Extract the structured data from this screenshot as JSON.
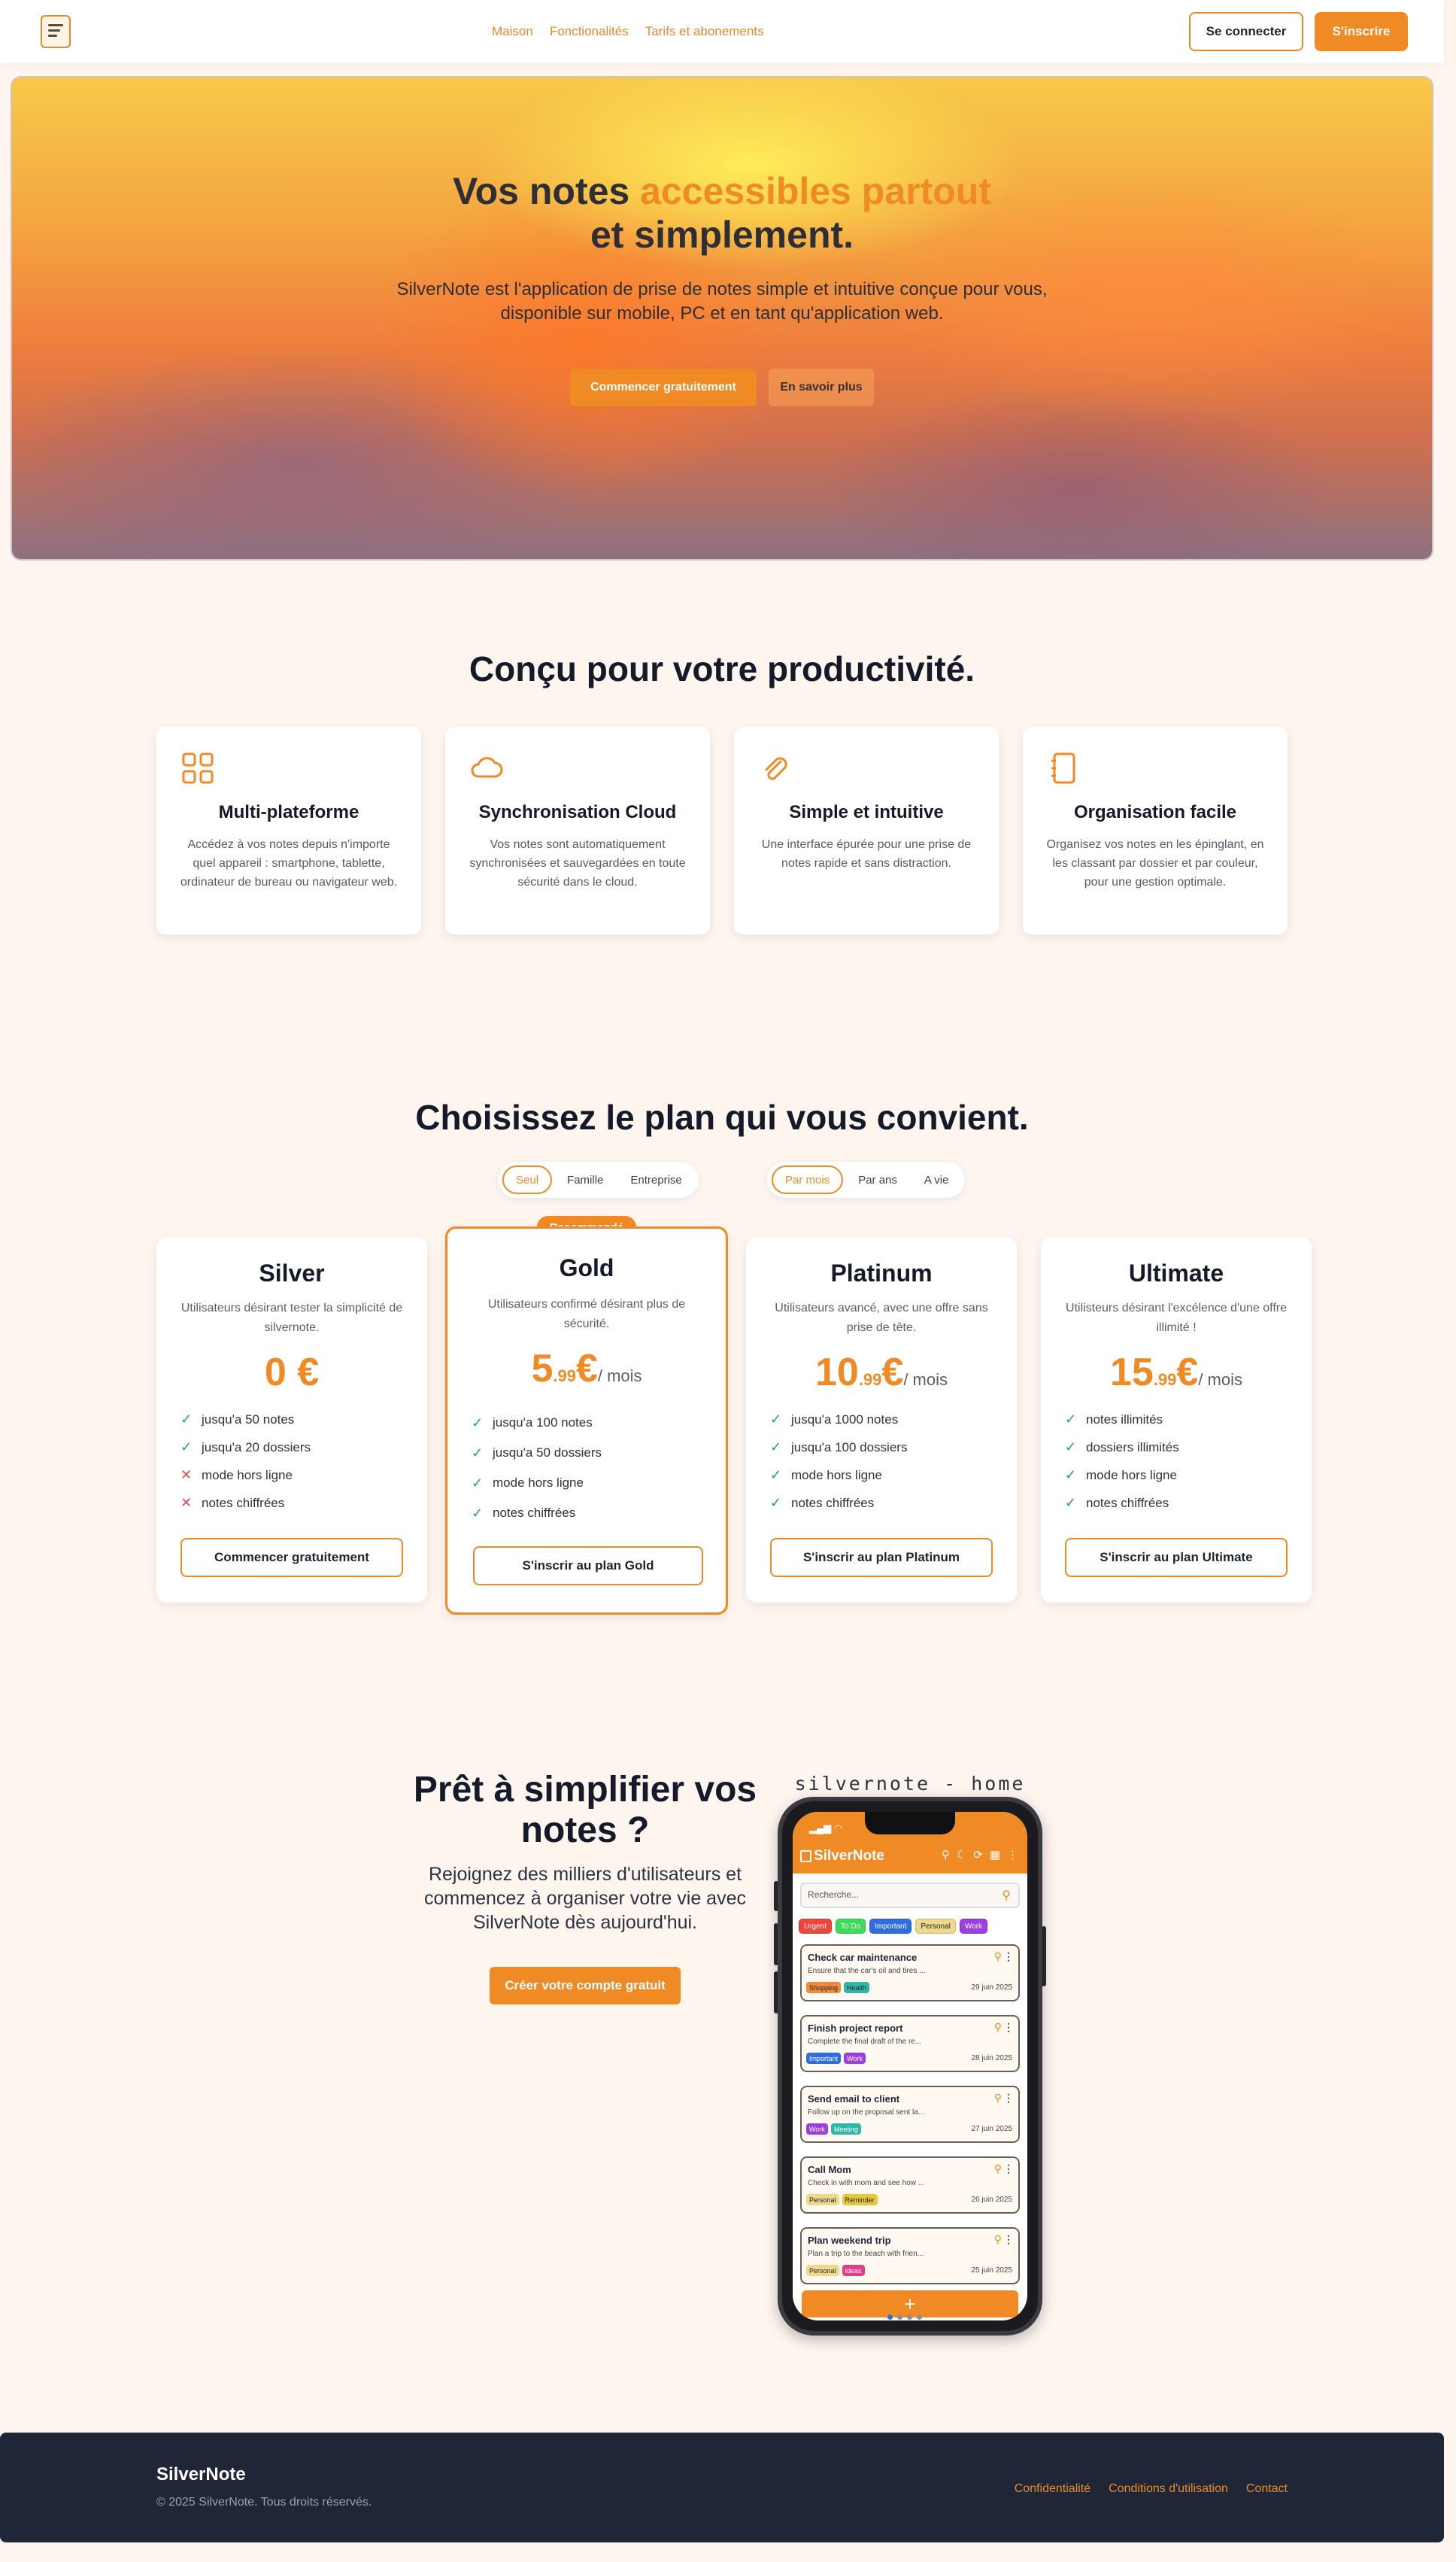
{
  "nav": {
    "links": [
      "Maison",
      "Fonctionalités",
      "Tarifs et abonements"
    ],
    "login": "Se connecter",
    "signup": "S'inscrire"
  },
  "hero": {
    "title_before": "Vos notes ",
    "title_accent": "accessibles partout",
    "title_after": " et simplement.",
    "subtitle": "SilverNote est l'application de prise de notes simple et intuitive conçue pour vous, disponible sur mobile, PC et en tant qu'application web.",
    "cta_primary": "Commencer gratuitement",
    "cta_secondary": "En savoir plus"
  },
  "features": {
    "title": "Conçu pour votre productivité.",
    "items": [
      {
        "icon": "grid-icon",
        "title": "Multi-plateforme",
        "desc": "Accédez à vos notes depuis n'importe quel appareil : smartphone, tablette, ordinateur de bureau ou navigateur web."
      },
      {
        "icon": "cloud-icon",
        "title": "Synchronisation Cloud",
        "desc": "Vos notes sont automatiquement synchronisées et sauvegardées en toute sécurité dans le cloud."
      },
      {
        "icon": "paperclip-icon",
        "title": "Simple et intuitive",
        "desc": "Une interface épurée pour une prise de notes rapide et sans distraction."
      },
      {
        "icon": "notebook-icon",
        "title": "Organisation facile",
        "desc": "Organisez vos notes en les épinglant, en les classant par dossier et par couleur, pour une gestion optimale."
      }
    ]
  },
  "pricing": {
    "title": "Choisissez le plan qui vous convient.",
    "audience_options": [
      "Seul",
      "Famille",
      "Entreprise"
    ],
    "audience_selected": "Seul",
    "period_options": [
      "Par mois",
      "Par ans",
      "A vie"
    ],
    "period_selected": "Par mois",
    "badge": "Recommandé",
    "plans": [
      {
        "name": "Silver",
        "desc": "Utilisateurs désirant tester la simplicité de silvernote.",
        "price": "0 €",
        "cents": "",
        "per": "",
        "features": [
          {
            "text": "jusqu'a 50 notes",
            "ok": true
          },
          {
            "text": "jusqu'a 20 dossiers",
            "ok": true
          },
          {
            "text": "mode hors ligne",
            "ok": false
          },
          {
            "text": "notes chiffrées",
            "ok": false
          }
        ],
        "button": "Commencer gratuitement"
      },
      {
        "name": "Gold",
        "desc": "Utilisateurs confirmé désirant plus de sécurité.",
        "price": "5",
        "cents": ".99",
        "euro": "€",
        "per": "/ mois",
        "features": [
          {
            "text": "jusqu'a 100 notes",
            "ok": true
          },
          {
            "text": "jusqu'a 50 dossiers",
            "ok": true
          },
          {
            "text": "mode hors ligne",
            "ok": true
          },
          {
            "text": "notes chiffrées",
            "ok": true
          }
        ],
        "button": "S'inscrir au plan Gold"
      },
      {
        "name": "Platinum",
        "desc": "Utilisateurs avancé, avec une offre sans prise de tête.",
        "price": "10",
        "cents": ".99",
        "euro": "€",
        "per": "/ mois",
        "features": [
          {
            "text": "jusqu'a 1000 notes",
            "ok": true
          },
          {
            "text": "jusqu'a 100 dossiers",
            "ok": true
          },
          {
            "text": "mode hors ligne",
            "ok": true
          },
          {
            "text": "notes chiffrées",
            "ok": true
          }
        ],
        "button": "S'inscrir au plan Platinum"
      },
      {
        "name": "Ultimate",
        "desc": "Utilisteurs désirant l'excélence d'une offre illimité !",
        "price": "15",
        "cents": ".99",
        "euro": "€",
        "per": "/ mois",
        "features": [
          {
            "text": "notes illimités",
            "ok": true
          },
          {
            "text": "dossiers illimités",
            "ok": true
          },
          {
            "text": "mode hors ligne",
            "ok": true
          },
          {
            "text": "notes chiffrées",
            "ok": true
          }
        ],
        "button": "S'inscrir au plan Ultimate"
      }
    ]
  },
  "cta": {
    "title": "Prêt à simplifier vos notes ?",
    "text": "Rejoignez des milliers d'utilisateurs et commencez à organiser votre vie avec SilverNote dès aujourd'hui.",
    "button": "Créer votre compte gratuit"
  },
  "phone": {
    "caption": "silvernote - home",
    "app_title": "SilverNote",
    "search_placeholder": "Recherche...",
    "chips": [
      {
        "label": "Urgent",
        "color": "#f0453a"
      },
      {
        "label": "To Do",
        "color": "#3fdc5a"
      },
      {
        "label": "Important",
        "color": "#2f6ee0"
      },
      {
        "label": "Personal",
        "color": "#efd88a"
      },
      {
        "label": "Work",
        "color": "#9b3fe0"
      }
    ],
    "notes": [
      {
        "title": "Check car maintenance",
        "text": "Ensure that the car's oil and tires ...",
        "tags": [
          {
            "label": "Shopping",
            "color": "#f08a3a"
          },
          {
            "label": "Health",
            "color": "#2fb8a8"
          }
        ],
        "date": "29 juin 2025"
      },
      {
        "title": "Finish project report",
        "text": "Complete the final draft of the re...",
        "tags": [
          {
            "label": "Important",
            "color": "#2f6ee0"
          },
          {
            "label": "Work",
            "color": "#9b3fe0"
          }
        ],
        "date": "28 juin 2025"
      },
      {
        "title": "Send email to client",
        "text": "Follow up on the proposal sent la...",
        "tags": [
          {
            "label": "Work",
            "color": "#9b3fe0"
          },
          {
            "label": "Meeting",
            "color": "#2fb8a8"
          }
        ],
        "date": "27 juin 2025"
      },
      {
        "title": "Call Mom",
        "text": "Check in with mom and see how ...",
        "tags": [
          {
            "label": "Personal",
            "color": "#efd88a"
          },
          {
            "label": "Reminder",
            "color": "#e8c83a"
          }
        ],
        "date": "26 juin 2025"
      },
      {
        "title": "Plan weekend trip",
        "text": "Plan a trip to the beach with frien...",
        "tags": [
          {
            "label": "Personal",
            "color": "#efd88a"
          },
          {
            "label": "Ideas",
            "color": "#e03f8a"
          }
        ],
        "date": "25 juin 2025"
      }
    ],
    "fab": "+"
  },
  "footer": {
    "brand": "SilverNote",
    "copyright": "© 2025 SilverNote. Tous droits réservés.",
    "links": [
      "Confidentialité",
      "Conditions d'utilisation",
      "Contact"
    ]
  },
  "colors": {
    "accent": "#ef8a25",
    "footer_bg": "#1e2637",
    "page_bg": "#fdf5ee"
  }
}
